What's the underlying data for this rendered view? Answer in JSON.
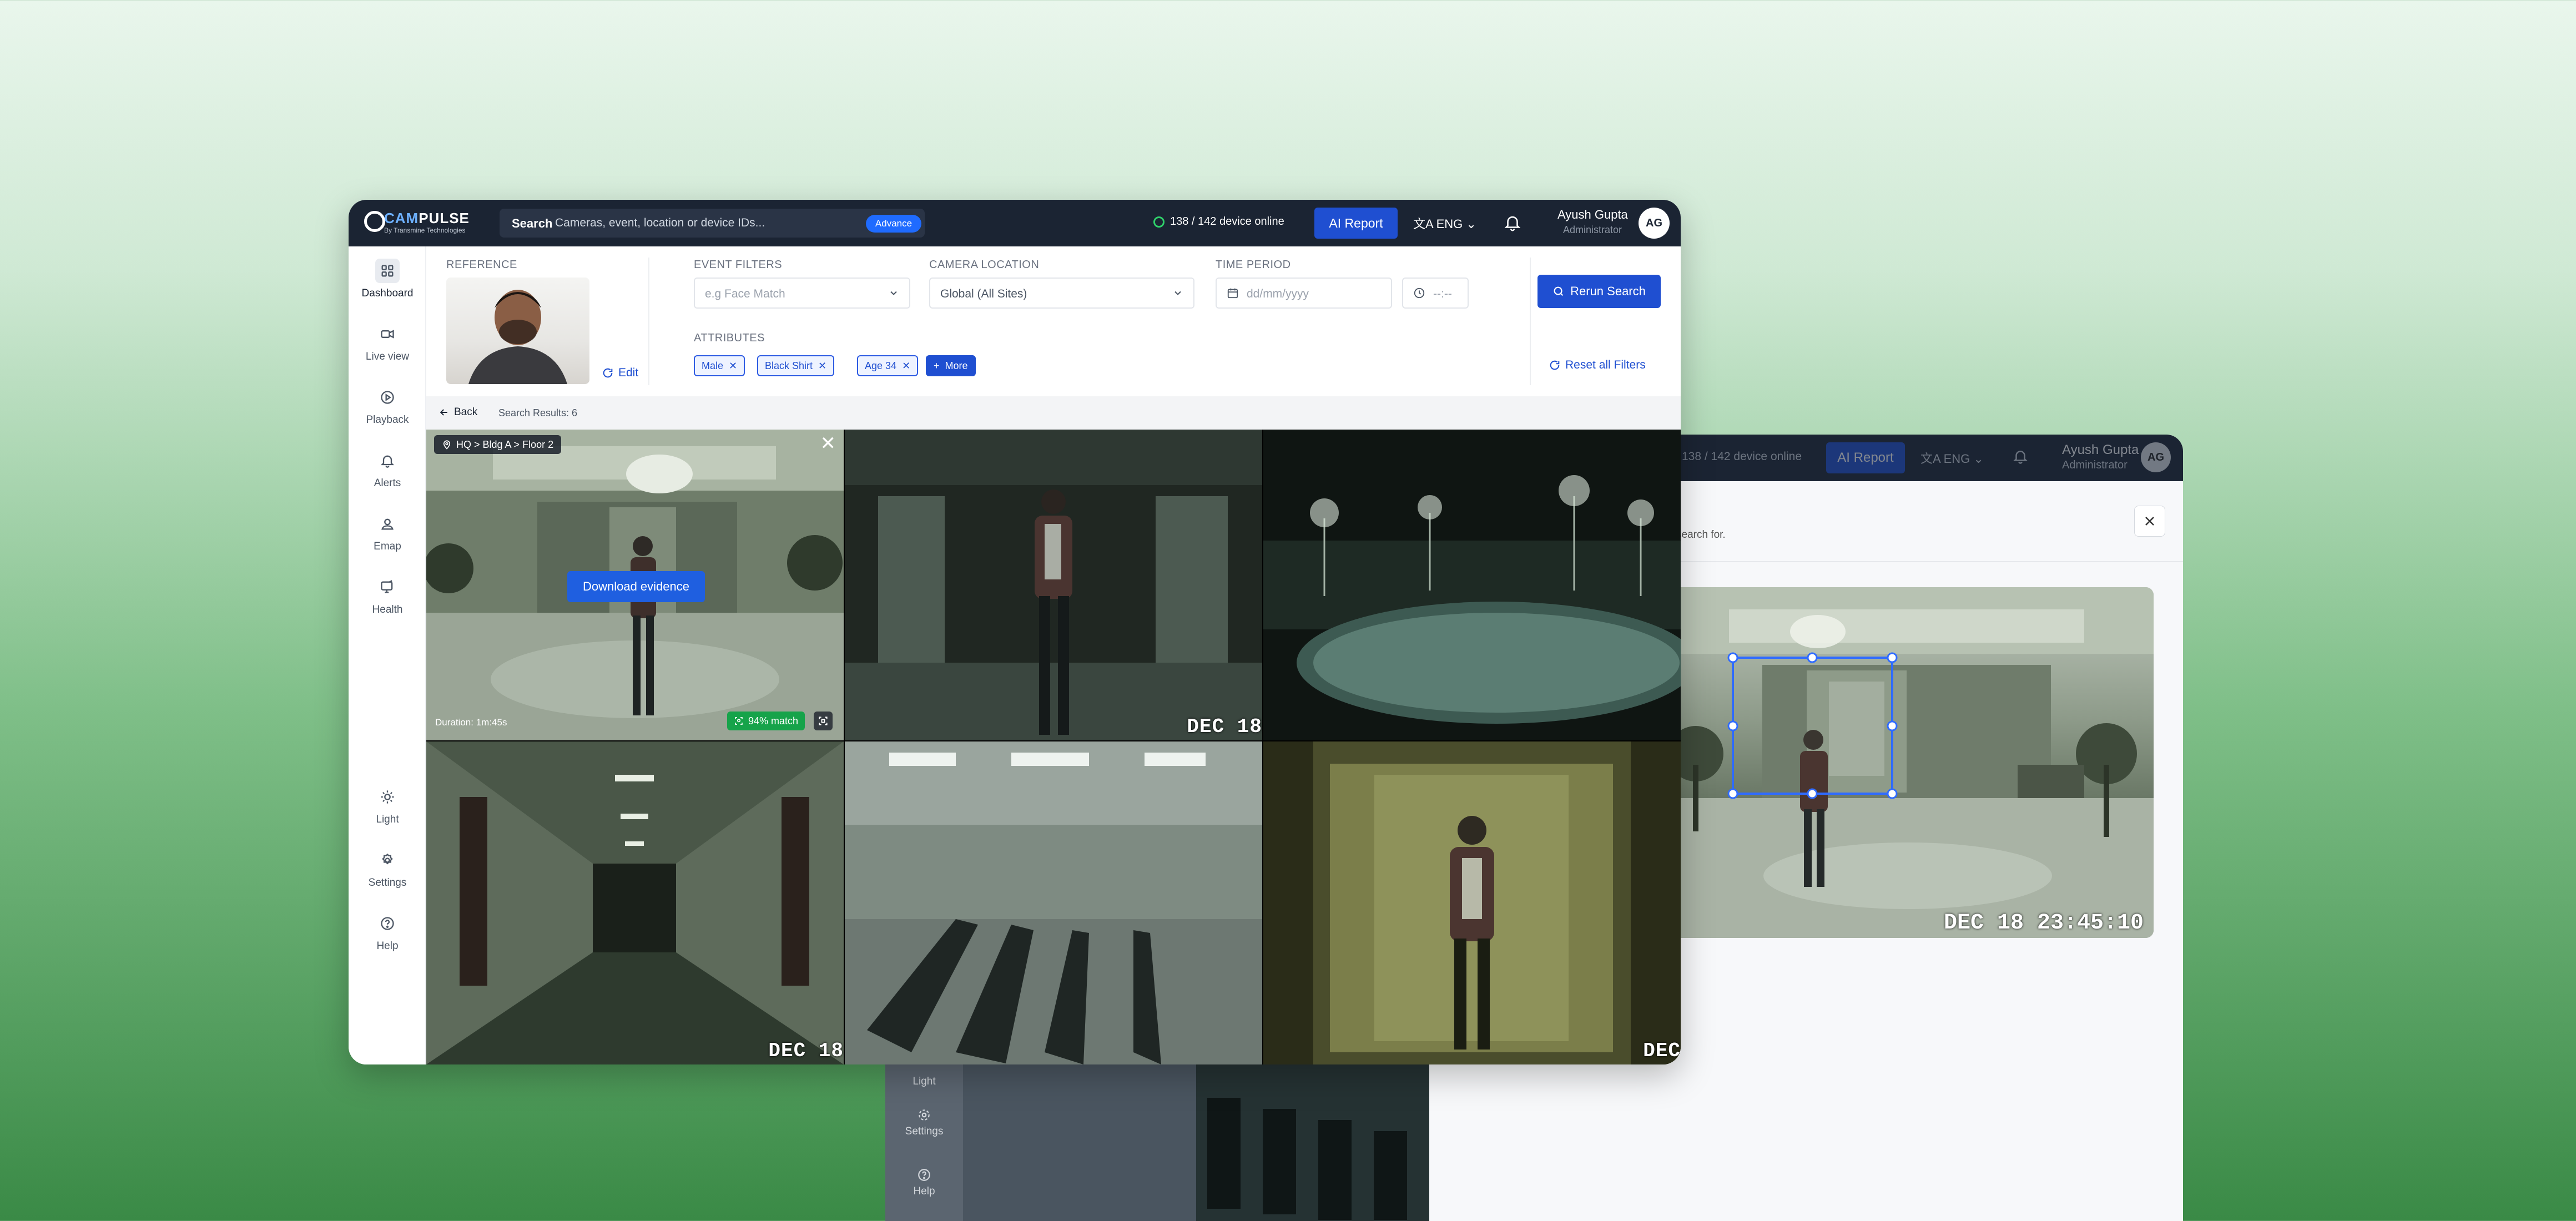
{
  "app": {
    "brand_prefix": "CAM",
    "brand_suffix": "PULSE",
    "brand_tagline": "By Transmine Technologies"
  },
  "topbar": {
    "search_label": "Search",
    "search_placeholder": "Cameras, event, location or device IDs...",
    "advance_label": "Advance",
    "device_status": "138 / 142 device online",
    "ai_report_label": "AI Report",
    "language": "ENG",
    "user_name": "Ayush Gupta",
    "user_role": "Administrator",
    "user_initials": "AG"
  },
  "sidebar": {
    "items": [
      {
        "label": "Dashboard",
        "icon": "dashboard-icon"
      },
      {
        "label": "Live view",
        "icon": "video-camera-icon"
      },
      {
        "label": "Playback",
        "icon": "play-circle-icon"
      },
      {
        "label": "Alerts",
        "icon": "bell-icon"
      },
      {
        "label": "Emap",
        "icon": "map-person-icon"
      },
      {
        "label": "Health",
        "icon": "health-monitor-icon"
      }
    ],
    "bottom_items": [
      {
        "label": "Light",
        "icon": "sun-icon"
      },
      {
        "label": "Settings",
        "icon": "gear-icon"
      },
      {
        "label": "Help",
        "icon": "help-circle-icon"
      }
    ]
  },
  "filters": {
    "reference_label": "REFERENCE",
    "edit_label": "Edit",
    "event_filters_label": "EVENT FILTERS",
    "event_filters_placeholder": "e.g Face Match",
    "camera_location_label": "CAMERA LOCATION",
    "camera_location_value": "Global (All Sites)",
    "time_period_label": "TIME PERIOD",
    "date_placeholder": "dd/mm/yyyy",
    "time_placeholder": "--:--",
    "attributes_label": "ATTRIBUTES",
    "attributes": [
      "Male",
      "Black Shirt",
      "Age 34"
    ],
    "more_label": "More",
    "rerun_label": "Rerun Search",
    "reset_label": "Reset all Filters"
  },
  "results": {
    "back_label": "Back",
    "count_label": "Search Results: 6"
  },
  "grid": {
    "tile1": {
      "location": "HQ > Bldg A > Floor 2",
      "download_label": "Download evidence",
      "duration": "Duration: 1m:45s",
      "match": "94% match"
    },
    "date_labels": [
      "DEC 18",
      "DEC 18",
      "DEC"
    ]
  },
  "back_window": {
    "device_status": "138 / 142 device online",
    "ai_report_label": "AI Report",
    "language": "ENG",
    "user_name": "Ayush Gupta",
    "user_role": "Administrator",
    "user_initials": "AG",
    "subtitle_fragment": "search for.",
    "image_timestamp": "DEC 18 23:45:10",
    "sidebar_items": [
      "Light",
      "Settings",
      "Help"
    ]
  }
}
